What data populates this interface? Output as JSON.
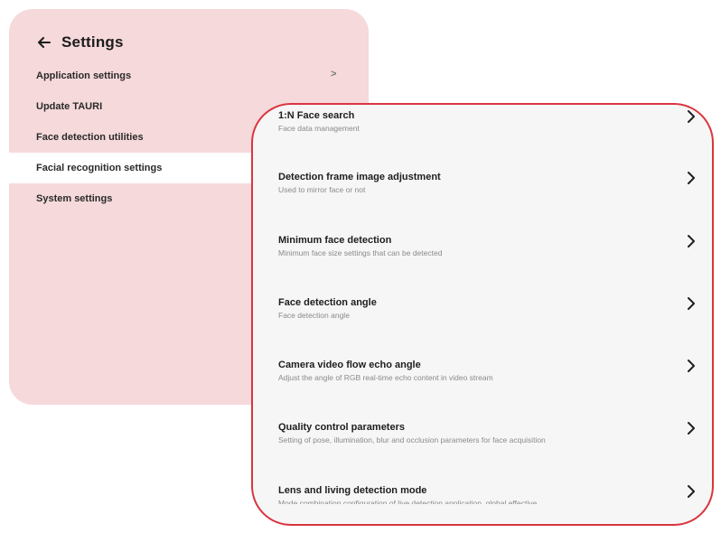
{
  "settings": {
    "title": "Settings",
    "back_icon": "arrow-left-icon",
    "menu": [
      {
        "label": "Application settings",
        "chevron": ">"
      },
      {
        "label": "Update TAURI"
      },
      {
        "label": "Face detection utilities"
      },
      {
        "label": "Facial recognition settings",
        "active": true
      },
      {
        "label": "System settings"
      }
    ]
  },
  "detail": {
    "accent_border": "#d9353f",
    "items": [
      {
        "title": "1:N Face search",
        "subtitle": "Face data management"
      },
      {
        "title": "Detection frame image adjustment",
        "subtitle": "Used to mirror face or not"
      },
      {
        "title": "Minimum face detection",
        "subtitle": "Minimum face size settings that can be detected"
      },
      {
        "title": "Face detection angle",
        "subtitle": "Face detection angle"
      },
      {
        "title": "Camera video flow echo angle",
        "subtitle": "Adjust the angle of RGB real-time echo content in video stream"
      },
      {
        "title": "Quality control parameters",
        "subtitle": "Setting of pose, illumination, blur and occlusion parameters for face acquisition"
      },
      {
        "title": "Lens and living detection mode",
        "subtitle": "Mode combination configuration of live detection application, global effective"
      }
    ]
  },
  "colors": {
    "settings_bg": "#f6d9db",
    "detail_bg": "#f6f6f6"
  }
}
